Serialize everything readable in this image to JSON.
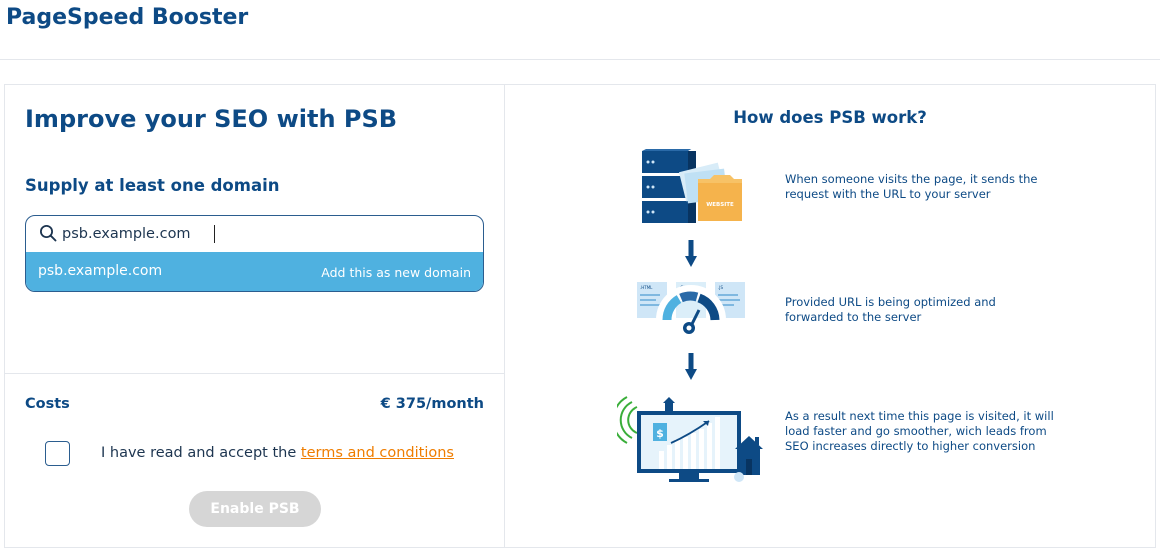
{
  "app": {
    "title": "PageSpeed Booster"
  },
  "left": {
    "heading": "Improve your SEO with PSB",
    "subheading": "Supply at least one domain",
    "search": {
      "value": "psb.example.com",
      "placeholder": ""
    },
    "suggestion": {
      "value": "psb.example.com",
      "action": "Add this as new domain"
    },
    "costs": {
      "label": "Costs",
      "value": "€ 375/month"
    },
    "accept": {
      "text": "I have read and accept the ",
      "link": "terms and conditions",
      "checked": false
    },
    "enable_button": "Enable PSB"
  },
  "right": {
    "heading": "How does PSB work?",
    "steps": [
      {
        "icon": "server-website-icon",
        "text": "When someone visits the page, it sends the request with the URL to your server"
      },
      {
        "icon": "optimize-gauge-icon",
        "text": "Provided URL is being optimized and forwarded to the server"
      },
      {
        "icon": "growth-monitor-icon",
        "text": "As a result next time this page is visited, it will load faster and go smoother, wich leads from SEO increases directly to higher conversion"
      }
    ],
    "step_illustration_labels": {
      "website": "WEBSITE",
      "html": ".HTML",
      "css": ".CSS",
      "js": ".JS",
      "currency": "$"
    }
  },
  "colors": {
    "brand": "#0d4a85",
    "accent": "#4fb1e0",
    "link": "#ef7d00",
    "disabled": "#d6d6d6"
  }
}
